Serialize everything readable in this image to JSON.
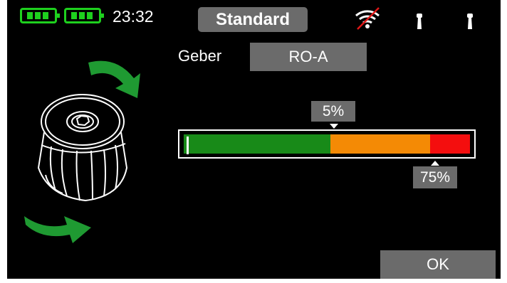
{
  "status_bar": {
    "battery_1_icon": "battery-full-icon",
    "battery_2_icon": "battery-full-icon",
    "battery_color": "#1ed01e",
    "time": "23:32",
    "mode": "Standard",
    "signal_icon": "wifi-disconnected-icon",
    "antenna_icons": [
      "antenna-icon",
      "antenna-icon"
    ]
  },
  "form": {
    "geber_label": "Geber",
    "geber_value": "RO-A"
  },
  "range": {
    "low_limit": "5%",
    "high_limit": "75%",
    "segments": [
      {
        "color": "#188a18",
        "share": 0.512
      },
      {
        "color": "#f48a05",
        "share": 0.348
      },
      {
        "color": "#f40e0e",
        "share": 0.14
      }
    ]
  },
  "illustration": {
    "knob_icon": "rotary-knob-icon",
    "arrow_icons": [
      "curved-arrow-clockwise-icon",
      "curved-arrow-clockwise-icon"
    ],
    "arrow_color": "#1f9a32"
  },
  "actions": {
    "ok_label": "OK"
  },
  "colors": {
    "background": "#000000",
    "button_gray": "#6b6b6b"
  }
}
